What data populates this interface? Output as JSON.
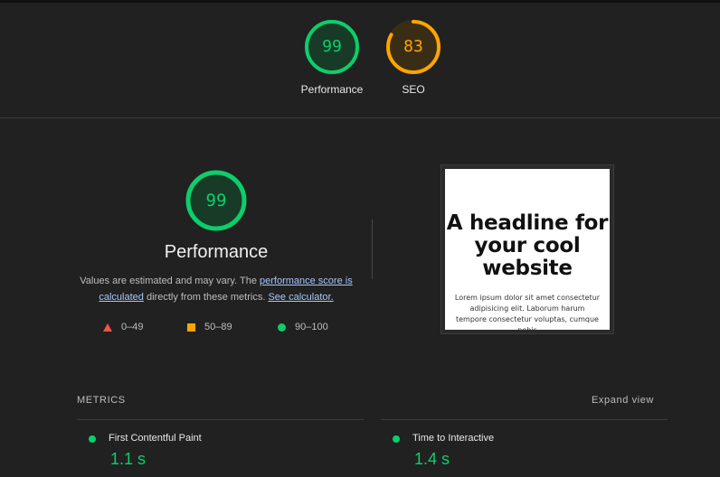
{
  "colors": {
    "pass": "#0cce6b",
    "average": "#ffa400",
    "fail": "#ff4e42",
    "background": "#212121"
  },
  "top_gauges": [
    {
      "score": "99",
      "label": "Performance",
      "rating": "pass",
      "fraction": 0.99
    },
    {
      "score": "83",
      "label": "SEO",
      "rating": "average",
      "fraction": 0.83
    }
  ],
  "performance": {
    "score": "99",
    "fraction": 0.99,
    "title": "Performance",
    "desc_prefix": "Values are estimated and may vary. The ",
    "link_score": "performance score is calculated",
    "desc_middle": " directly from these metrics. ",
    "link_calculator": "See calculator."
  },
  "legend": [
    {
      "icon": "triangle-icon",
      "range": "0–49"
    },
    {
      "icon": "square-icon",
      "range": "50–89"
    },
    {
      "icon": "circle-icon",
      "range": "90–100"
    }
  ],
  "preview": {
    "headline": "A headline for your cool website",
    "body": "Lorem ipsum dolor sit amet consectetur adipisicing elit. Laborum harum tempore consectetur voluptas, cumque nobis"
  },
  "metrics": {
    "label": "METRICS",
    "expand": "Expand view",
    "items": [
      {
        "name": "First Contentful Paint",
        "value": "1.1 s"
      },
      {
        "name": "Time to Interactive",
        "value": "1.4 s"
      }
    ]
  }
}
